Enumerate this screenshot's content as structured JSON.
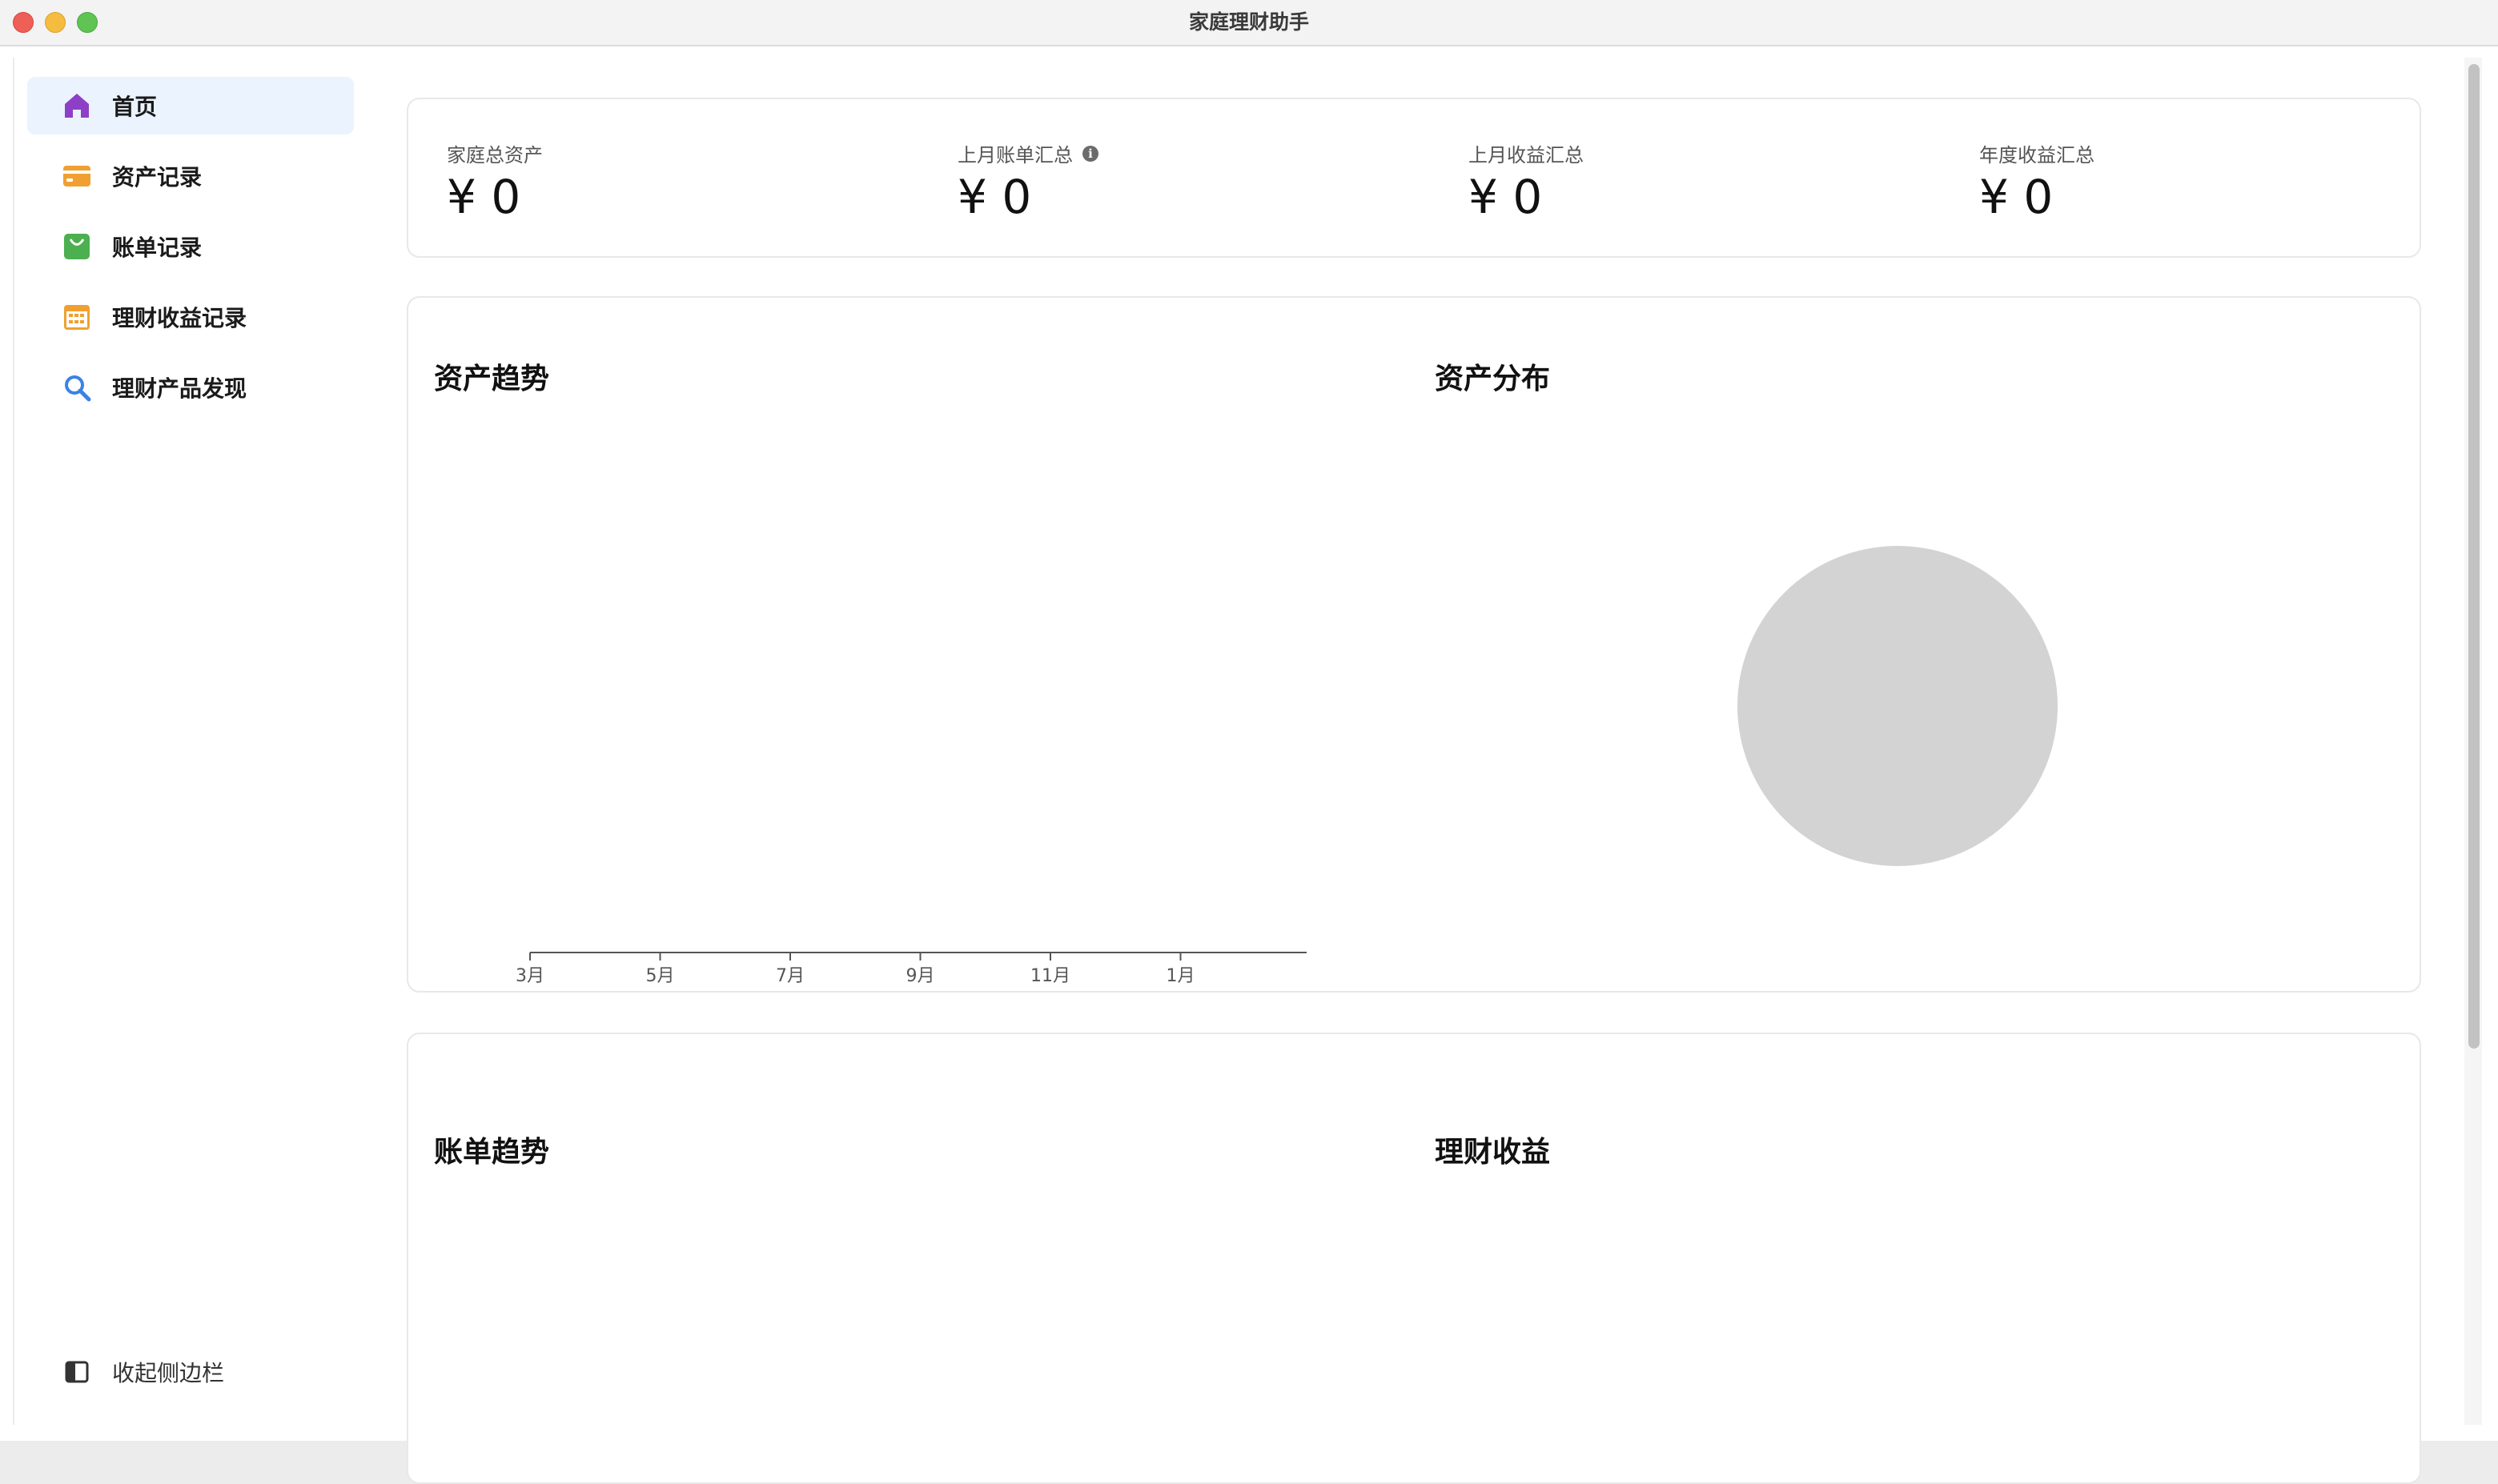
{
  "window": {
    "title": "家庭理财助手"
  },
  "sidebar": {
    "items": [
      {
        "label": "首页",
        "icon": "home-icon",
        "color": "#8e3fc7",
        "active": true
      },
      {
        "label": "资产记录",
        "icon": "card-icon",
        "color": "#f0a030",
        "active": false
      },
      {
        "label": "账单记录",
        "icon": "bag-icon",
        "color": "#4caf50",
        "active": false
      },
      {
        "label": "理财收益记录",
        "icon": "calendar-icon",
        "color": "#f0a030",
        "active": false
      },
      {
        "label": "理财产品发现",
        "icon": "search-icon",
        "color": "#3b82e6",
        "active": false
      }
    ],
    "collapse_label": "收起侧边栏"
  },
  "stats": [
    {
      "label": "家庭总资产",
      "value": "¥ 0",
      "info": false
    },
    {
      "label": "上月账单汇总",
      "value": "¥ 0",
      "info": true
    },
    {
      "label": "上月收益汇总",
      "value": "¥ 0",
      "info": false
    },
    {
      "label": "年度收益汇总",
      "value": "¥ 0",
      "info": false
    }
  ],
  "sections": {
    "asset_trend": "资产趋势",
    "asset_distribution": "资产分布",
    "bill_trend": "账单趋势",
    "investment_income": "理财收益"
  },
  "chart_data": [
    {
      "type": "line",
      "title": "资产趋势",
      "x": [
        "3月",
        "5月",
        "7月",
        "9月",
        "11月",
        "1月"
      ],
      "series": [],
      "xlabel": "",
      "ylabel": "",
      "grid": false
    },
    {
      "type": "pie",
      "title": "资产分布",
      "slices": [],
      "empty_color": "#d3d3d3"
    }
  ]
}
